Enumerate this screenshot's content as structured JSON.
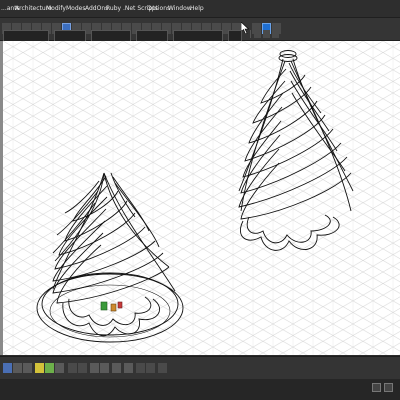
{
  "menu": {
    "items": [
      "...ants",
      "Architecture",
      "Modify",
      "Modes",
      "AddOns",
      "Ruby .Net Scripts",
      "Options",
      "Window",
      "Help"
    ]
  },
  "icons": {
    "cursor": "arrow-cursor-icon",
    "viewport_tool": "tube-cursor-icon"
  },
  "colors": {
    "menubar_bg": "#2e2e2e",
    "toolbar_bg": "#353535",
    "viewport_bg": "#ffffff",
    "grid": "#c9c9c9",
    "wire": "#111111",
    "accent": "#2f5ea8"
  }
}
